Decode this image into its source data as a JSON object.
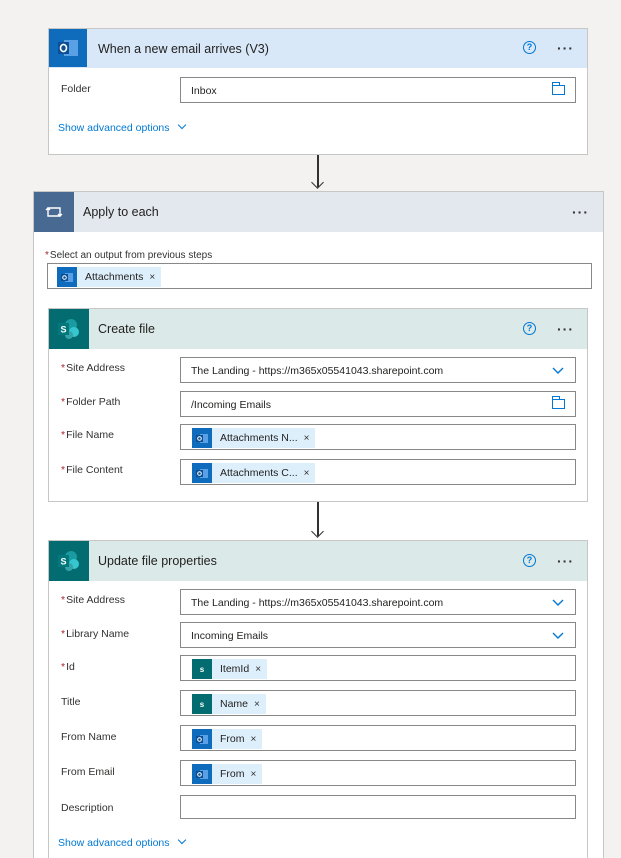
{
  "trigger": {
    "title": "When a new email arrives (V3)",
    "folder_label": "Folder",
    "folder_value": "Inbox",
    "advanced_label": "Show advanced options",
    "icon": "outlook-icon",
    "color": "#d8e8f8"
  },
  "apply_each": {
    "title": "Apply to each",
    "select_label": "Select an output from previous steps",
    "token_label": "Attachments",
    "icon": "loop-icon",
    "header_color": "#e3e8ee",
    "icon_bg": "#486991"
  },
  "create_file": {
    "title": "Create file",
    "icon": "sharepoint-icon",
    "header_color": "#dbe9e8",
    "fields": {
      "site_address": {
        "label": "Site Address",
        "value": "The Landing - https://m365x05541043.sharepoint.com"
      },
      "folder_path": {
        "label": "Folder Path",
        "value": "/Incoming Emails"
      },
      "file_name": {
        "label": "File Name",
        "token": "Attachments N..."
      },
      "file_content": {
        "label": "File Content",
        "token": "Attachments C..."
      }
    }
  },
  "update_file": {
    "title": "Update file properties",
    "icon": "sharepoint-icon",
    "header_color": "#dbe9e8",
    "advanced_label": "Show advanced options",
    "fields": {
      "site_address": {
        "label": "Site Address",
        "value": "The Landing - https://m365x05541043.sharepoint.com"
      },
      "library_name": {
        "label": "Library Name",
        "value": "Incoming Emails"
      },
      "id": {
        "label": "Id",
        "token": "ItemId"
      },
      "title": {
        "label": "Title",
        "token": "Name"
      },
      "from_name": {
        "label": "From Name",
        "token": "From"
      },
      "from_email": {
        "label": "From Email",
        "token": "From"
      },
      "description": {
        "label": "Description",
        "value": ""
      }
    }
  },
  "common": {
    "required_mark": "*",
    "remove_mark": "×",
    "help_mark": "?",
    "more_mark": "···"
  },
  "colors": {
    "accent": "#0078d4",
    "outlook": "#0f6cbd",
    "sharepoint": "#036c70"
  }
}
